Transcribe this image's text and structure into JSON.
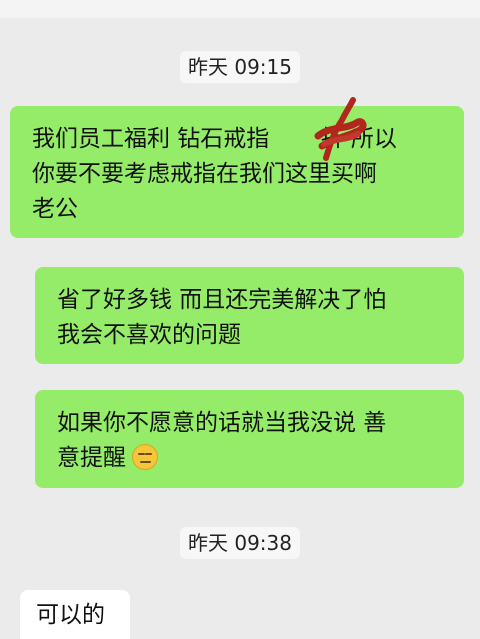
{
  "chat": {
    "timestamps": [
      "昨天 09:15",
      "昨天 09:38"
    ],
    "messages": [
      {
        "side": "sent",
        "lines": [
          "我们员工福利 钻石戒指 ",
          "折 所以",
          "你要不要考虑戒指在我们这里买啊",
          "老公"
        ]
      },
      {
        "side": "sent",
        "lines": [
          "省了好多钱 而且还完美解决了怕",
          "我会不喜欢的问题"
        ]
      },
      {
        "side": "sent",
        "lines": [
          "如果你不愿意的话就当我没说 善",
          "意提醒"
        ],
        "emoji": "expressionless-face-emoji"
      },
      {
        "side": "received",
        "lines": [
          "可以的"
        ]
      }
    ]
  },
  "colors": {
    "background": "#ebebeb",
    "sent_bubble": "#95ec69",
    "received_bubble": "#ffffff",
    "redaction_scribble": "#b3261e"
  }
}
